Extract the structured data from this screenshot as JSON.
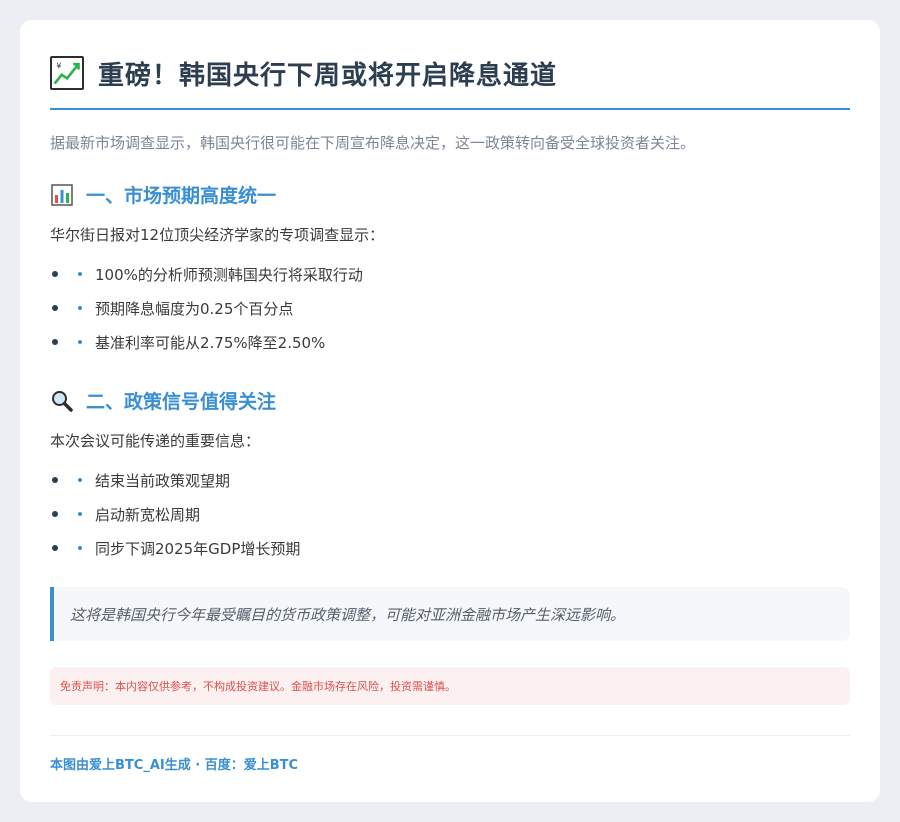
{
  "header": {
    "title": "重磅！韩国央行下周或将开启降息通道",
    "icon": "chart-increasing-icon"
  },
  "intro": "据最新市场调查显示，韩国央行很可能在下周宣布降息决定，这一政策转向备受全球投资者关注。",
  "sections": [
    {
      "icon": "bar-chart-icon",
      "heading": "一、市场预期高度统一",
      "lead": "华尔街日报对12位顶尖经济学家的专项调查显示：",
      "items": [
        "100%的分析师预测韩国央行将采取行动",
        "预期降息幅度为0.25个百分点",
        "基准利率可能从2.75%降至2.50%"
      ]
    },
    {
      "icon": "magnifier-icon",
      "heading": "二、政策信号值得关注",
      "lead": "本次会议可能传递的重要信息：",
      "items": [
        "结束当前政策观望期",
        "启动新宽松周期",
        "同步下调2025年GDP增长预期"
      ]
    }
  ],
  "quote": "这将是韩国央行今年最受瞩目的货币政策调整，可能对亚洲金融市场产生深远影响。",
  "disclaimer": "免责声明：本内容仅供参考，不构成投资建议。金融市场存在风险，投资需谨慎。",
  "footer": "本图由爱上BTC_AI生成 · 百度：爱上BTC",
  "colors": {
    "accent": "#3a8fd3",
    "title": "#2c3e50",
    "disclaimer": "#d9534f"
  }
}
